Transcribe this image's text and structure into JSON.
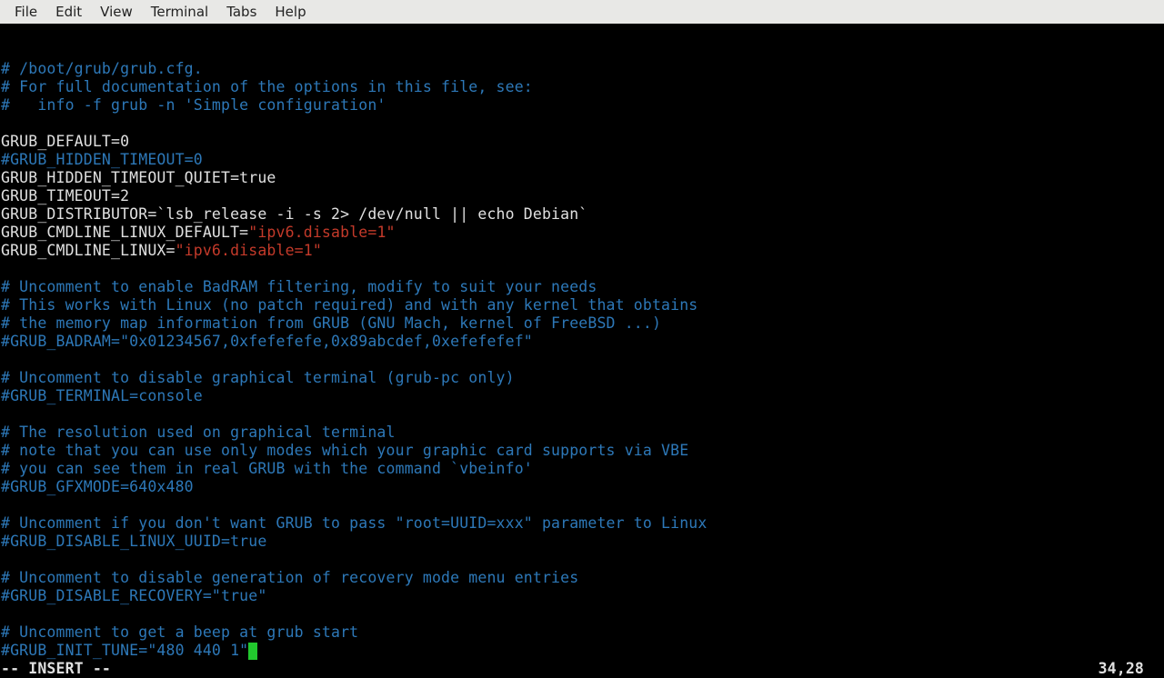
{
  "menubar": {
    "items": [
      "File",
      "Edit",
      "View",
      "Terminal",
      "Tabs",
      "Help"
    ]
  },
  "editor": {
    "lines": [
      [
        {
          "c": "comment",
          "t": "# /boot/grub/grub.cfg."
        }
      ],
      [
        {
          "c": "comment",
          "t": "# For full documentation of the options in this file, see:"
        }
      ],
      [
        {
          "c": "comment",
          "t": "#   info -f grub -n 'Simple configuration'"
        }
      ],
      [],
      [
        {
          "c": "normal",
          "t": "GRUB_DEFAULT=0"
        }
      ],
      [
        {
          "c": "comment",
          "t": "#GRUB_HIDDEN_TIMEOUT=0"
        }
      ],
      [
        {
          "c": "normal",
          "t": "GRUB_HIDDEN_TIMEOUT_QUIET=true"
        }
      ],
      [
        {
          "c": "normal",
          "t": "GRUB_TIMEOUT=2"
        }
      ],
      [
        {
          "c": "normal",
          "t": "GRUB_DISTRIBUTOR=`lsb_release -i -s 2> /dev/null || echo Debian`"
        }
      ],
      [
        {
          "c": "normal",
          "t": "GRUB_CMDLINE_LINUX_DEFAULT="
        },
        {
          "c": "string",
          "t": "\"ipv6.disable=1\""
        }
      ],
      [
        {
          "c": "normal",
          "t": "GRUB_CMDLINE_LINUX="
        },
        {
          "c": "string",
          "t": "\"ipv6.disable=1\""
        }
      ],
      [],
      [
        {
          "c": "comment",
          "t": "# Uncomment to enable BadRAM filtering, modify to suit your needs"
        }
      ],
      [
        {
          "c": "comment",
          "t": "# This works with Linux (no patch required) and with any kernel that obtains"
        }
      ],
      [
        {
          "c": "comment",
          "t": "# the memory map information from GRUB (GNU Mach, kernel of FreeBSD ...)"
        }
      ],
      [
        {
          "c": "comment",
          "t": "#GRUB_BADRAM=\"0x01234567,0xfefefefe,0x89abcdef,0xefefefef\""
        }
      ],
      [],
      [
        {
          "c": "comment",
          "t": "# Uncomment to disable graphical terminal (grub-pc only)"
        }
      ],
      [
        {
          "c": "comment",
          "t": "#GRUB_TERMINAL=console"
        }
      ],
      [],
      [
        {
          "c": "comment",
          "t": "# The resolution used on graphical terminal"
        }
      ],
      [
        {
          "c": "comment",
          "t": "# note that you can use only modes which your graphic card supports via VBE"
        }
      ],
      [
        {
          "c": "comment",
          "t": "# you can see them in real GRUB with the command `vbeinfo'"
        }
      ],
      [
        {
          "c": "comment",
          "t": "#GRUB_GFXMODE=640x480"
        }
      ],
      [],
      [
        {
          "c": "comment",
          "t": "# Uncomment if you don't want GRUB to pass \"root=UUID=xxx\" parameter to Linux"
        }
      ],
      [
        {
          "c": "comment",
          "t": "#GRUB_DISABLE_LINUX_UUID=true"
        }
      ],
      [],
      [
        {
          "c": "comment",
          "t": "# Uncomment to disable generation of recovery mode menu entries"
        }
      ],
      [
        {
          "c": "comment",
          "t": "#GRUB_DISABLE_RECOVERY=\"true\""
        }
      ],
      [],
      [
        {
          "c": "comment",
          "t": "# Uncomment to get a beep at grub start"
        }
      ],
      [
        {
          "c": "comment",
          "t": "#GRUB_INIT_TUNE=\"480 440 1\""
        },
        {
          "c": "cursor"
        }
      ]
    ],
    "mode": "-- INSERT --",
    "position": "34,28"
  }
}
